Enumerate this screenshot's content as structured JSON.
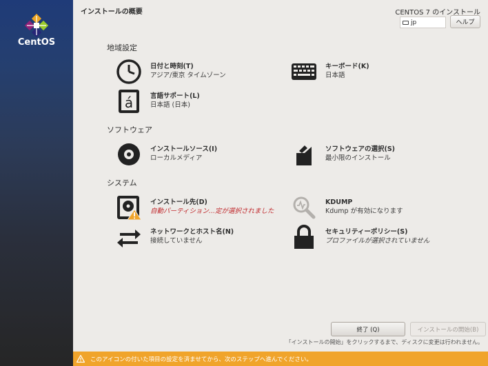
{
  "brand": {
    "logo_text": "CentOS"
  },
  "header": {
    "title": "インストールの概要",
    "product": "CENTOS 7 のインストール",
    "keyboard_layout": "jp",
    "help_label": "ヘルプ"
  },
  "sections": {
    "localization": {
      "title": "地域設定",
      "datetime": {
        "title": "日付と時刻(T)",
        "status": "アジア/東京 タイムゾーン",
        "icon": "clock-icon"
      },
      "keyboard": {
        "title": "キーボード(K)",
        "status": "日本語",
        "icon": "keyboard-icon"
      },
      "language": {
        "title": "言語サポート(L)",
        "status": "日本語 (日本)",
        "icon": "language-icon"
      }
    },
    "software": {
      "title": "ソフトウェア",
      "source": {
        "title": "インストールソース(I)",
        "status": "ローカルメディア",
        "icon": "disc-icon"
      },
      "selection": {
        "title": "ソフトウェアの選択(S)",
        "status": "最小限のインストール",
        "icon": "package-icon"
      }
    },
    "system": {
      "title": "システム",
      "destination": {
        "title": "インストール先(D)",
        "status": "自動パーティション...定が選択されました",
        "icon": "harddisk-warning-icon"
      },
      "kdump": {
        "title": "KDUMP",
        "status": "Kdump が有効になります",
        "icon": "magnifier-icon"
      },
      "network": {
        "title": "ネットワークとホスト名(N)",
        "status": "接続していません",
        "icon": "network-arrows-icon"
      },
      "security": {
        "title": "セキュリティーポリシー(S)",
        "status": "プロファイルが選択されていません",
        "icon": "lock-icon"
      }
    }
  },
  "footer": {
    "quit_label": "終了 (Q)",
    "begin_label": "インストールの開始(B)",
    "hint": "「インストールの開始」をクリックするまで、ディスクに変更は行われません。",
    "warning": "このアイコンの付いた項目の設定を済ませてから、次のステップへ進んでください。"
  },
  "colors": {
    "sidebar_top": "#1f3b78",
    "background": "#edebe8",
    "warning_bar": "#f0a42b",
    "warning_text": "#c0282c"
  }
}
